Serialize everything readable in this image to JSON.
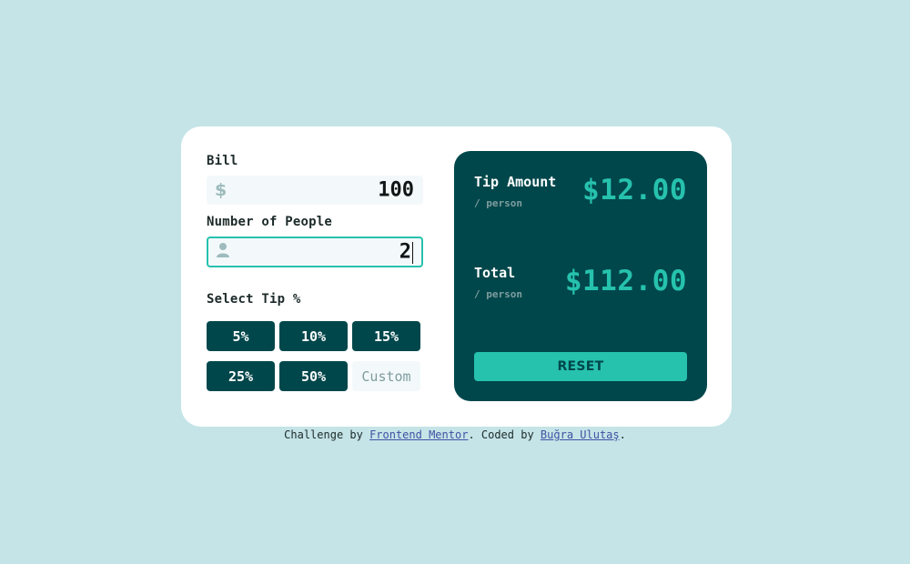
{
  "calculator": {
    "bill": {
      "label": "Bill",
      "prefix_symbol": "$",
      "value": "100",
      "icon": "dollar-icon"
    },
    "people": {
      "label": "Number of People",
      "value": "2",
      "icon": "person-icon",
      "focused": true
    },
    "tip": {
      "label": "Select Tip %",
      "options": [
        "5%",
        "10%",
        "15%",
        "25%",
        "50%"
      ],
      "custom_placeholder": "Custom"
    }
  },
  "results": {
    "tip_amount": {
      "label": "Tip Amount",
      "sub": "/ person",
      "value": "$12.00"
    },
    "total": {
      "label": "Total",
      "sub": "/ person",
      "value": "$112.00"
    },
    "reset_label": "RESET"
  },
  "footer": {
    "prefix": "Challenge by ",
    "link1": "Frontend Mentor",
    "middle": ". Coded by ",
    "link2": "Buğra Ulutaş",
    "suffix": "."
  },
  "colors": {
    "background": "#c5e4e7",
    "card": "#ffffff",
    "dark_cyan": "#00474b",
    "strong_cyan": "#26c2ae",
    "input_bg": "#f3f9fa",
    "grayish_cyan": "#7f9c9f"
  }
}
